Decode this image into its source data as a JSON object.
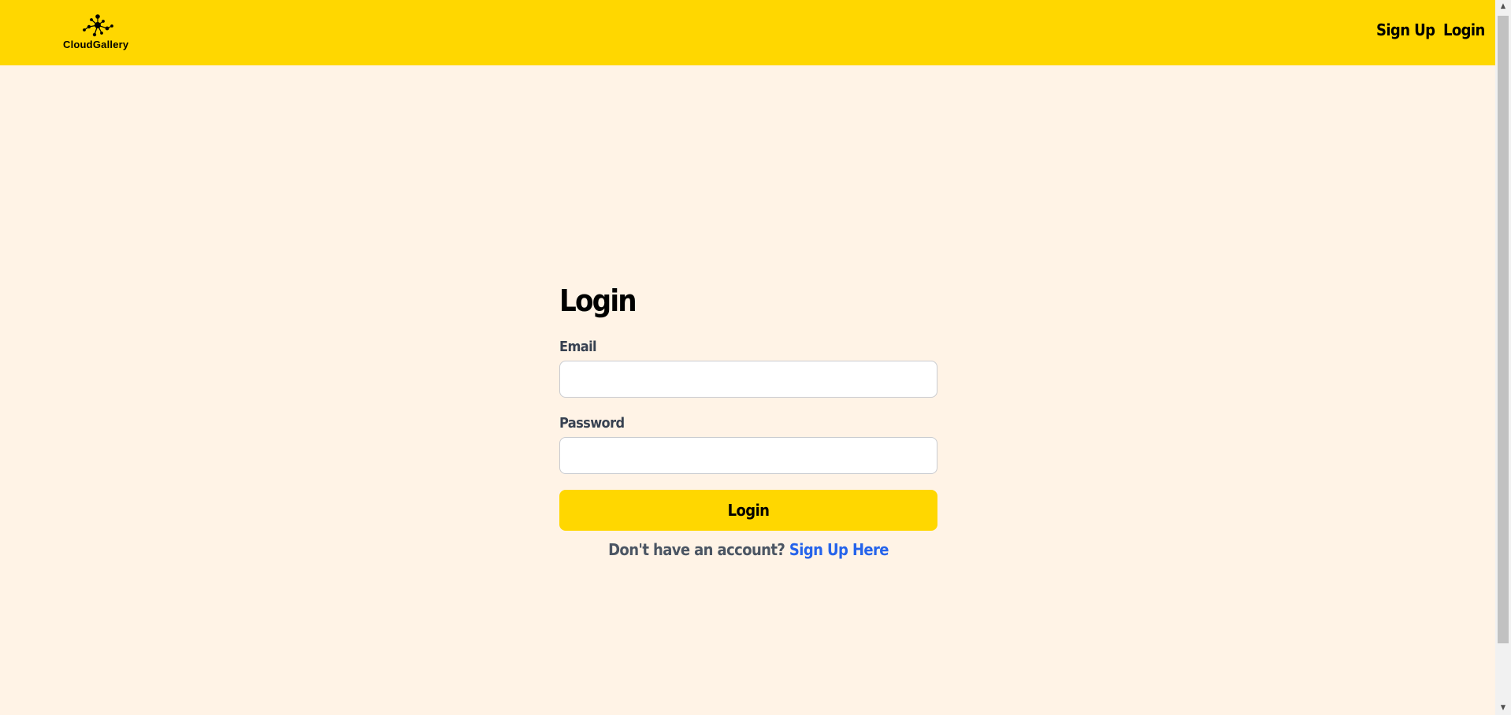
{
  "brand": {
    "name": "CloudGallery",
    "logo_icon": "network-nodes-icon"
  },
  "nav": {
    "signup_label": "Sign Up",
    "login_label": "Login"
  },
  "form": {
    "title": "Login",
    "email_label": "Email",
    "email_value": "",
    "password_label": "Password",
    "password_value": "",
    "submit_label": "Login",
    "prompt_text": "Don't have an account?",
    "signup_link_label": "Sign Up Here"
  },
  "colors": {
    "accent": "#FFD700",
    "background": "#FFF3E6",
    "link": "#2563EB",
    "label_text": "#374151"
  }
}
